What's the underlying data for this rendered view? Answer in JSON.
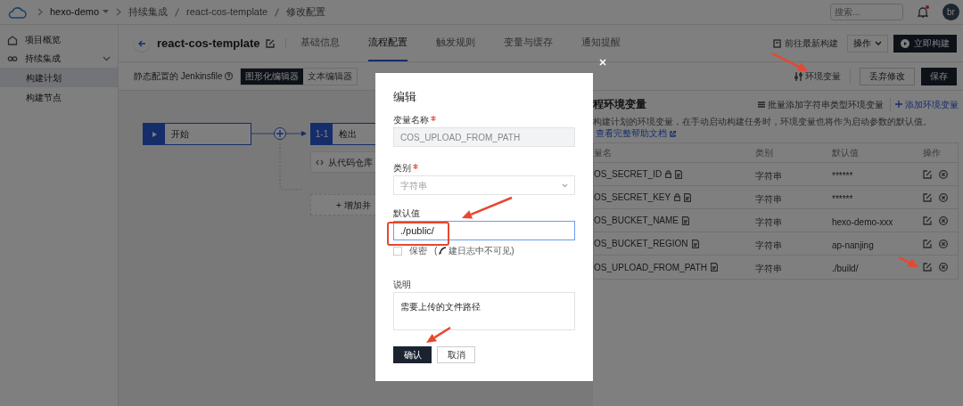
{
  "topbar": {
    "breadcrumbs": [
      {
        "label": "hexo-demo",
        "dropdown": true
      },
      {
        "label": "持续集成",
        "dropdown": false
      },
      {
        "label": "react-cos-template",
        "dropdown": false
      },
      {
        "label": "修改配置",
        "dropdown": false
      }
    ],
    "search": {
      "placeholder": "搜索..."
    },
    "notifications": {
      "unread": true
    },
    "avatar": "br"
  },
  "sidebar": {
    "items": [
      {
        "label": "项目概览",
        "selected": false
      },
      {
        "label": "持续集成",
        "selected": false,
        "expanded": true,
        "children": [
          {
            "label": "构建计划",
            "selected": true
          },
          {
            "label": "构建节点",
            "selected": false
          }
        ]
      }
    ]
  },
  "header": {
    "title": "react-cos-template",
    "tabs": [
      {
        "label": "基础信息",
        "selected": false
      },
      {
        "label": "流程配置",
        "selected": true
      },
      {
        "label": "触发规则",
        "selected": false
      },
      {
        "label": "变量与缓存",
        "selected": false
      },
      {
        "label": "通知提醒",
        "selected": false
      }
    ],
    "latest_build": "前往最新构建",
    "operations": "操作",
    "build_now": "立即构建"
  },
  "toolbar": {
    "label": "静态配置的 Jenkinsfile",
    "editor_modes": [
      {
        "label": "图形化编辑器",
        "selected": true
      },
      {
        "label": "文本编辑器",
        "selected": false
      }
    ],
    "env_button": "环境变量",
    "discard": "丢弃修改",
    "save": "保存"
  },
  "pipeline": {
    "start": "开始",
    "stage_index": "1-1",
    "stage_name": "检出",
    "step": "从代码仓库",
    "add_parallel": "+ 增加并"
  },
  "env_panel": {
    "title": "程环境变量",
    "batch_add": "批量添加字符串类型环境变量",
    "add": "添加环境变量",
    "description": "构建计划的环境变量，在手动启动构建任务时，环境变量也将作为启动参数的默认值。",
    "help_link": "查看完整帮助文档",
    "columns": [
      "量名",
      "类别",
      "默认值",
      "操作"
    ],
    "rows": [
      {
        "name": "OS_SECRET_ID",
        "secret": true,
        "type": "字符串",
        "value": "******"
      },
      {
        "name": "OS_SECRET_KEY",
        "secret": true,
        "type": "字符串",
        "value": "******"
      },
      {
        "name": "OS_BUCKET_NAME",
        "secret": false,
        "type": "字符串",
        "value": "hexo-demo-xxx"
      },
      {
        "name": "OS_BUCKET_REGION",
        "secret": false,
        "type": "字符串",
        "value": "ap-nanjing"
      },
      {
        "name": "OS_UPLOAD_FROM_PATH",
        "secret": false,
        "type": "字符串",
        "value": "./build/"
      }
    ]
  },
  "dialog": {
    "title": "编辑",
    "fields": [
      {
        "kind": "text",
        "label": "变量名称",
        "required": true,
        "value": "COS_UPLOAD_FROM_PATH",
        "disabled": true,
        "focused": false
      },
      {
        "kind": "select",
        "label": "类别",
        "required": true,
        "value": "字符串",
        "disabled": true,
        "focused": false
      },
      {
        "kind": "text",
        "label": "默认值",
        "required": false,
        "value": "./public/",
        "disabled": false,
        "focused": true
      }
    ],
    "secret": {
      "label": "保密",
      "checked": false,
      "hint_before": "(",
      "hint_after": "建日志中不可见)"
    },
    "description": {
      "label": "说明",
      "value": "需要上传的文件路径"
    },
    "buttons": [
      {
        "label": "确认",
        "primary": true
      },
      {
        "label": "取消",
        "primary": false
      }
    ]
  }
}
